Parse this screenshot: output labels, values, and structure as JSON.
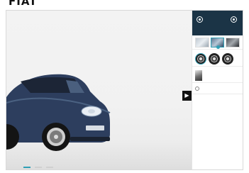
{
  "brand": {
    "name": "FIAT"
  },
  "colors": {
    "accent": "#2f9fb5",
    "header_bg": "#1b3446",
    "body_paint": "#2d3e5e"
  },
  "viewer": {
    "next_icon": "chevron-right-icon",
    "next_glyph": "▶"
  },
  "panel": {
    "header": {
      "title": "",
      "toggle_1": "",
      "toggle_2": ""
    },
    "colors_section": {
      "title": "",
      "subtitle": ""
    },
    "wheels_section": {
      "title": "",
      "subtitle": ""
    },
    "interior_section": {
      "title": "",
      "description": ""
    },
    "options_section": {
      "title": "",
      "option": "",
      "bullets": []
    }
  }
}
